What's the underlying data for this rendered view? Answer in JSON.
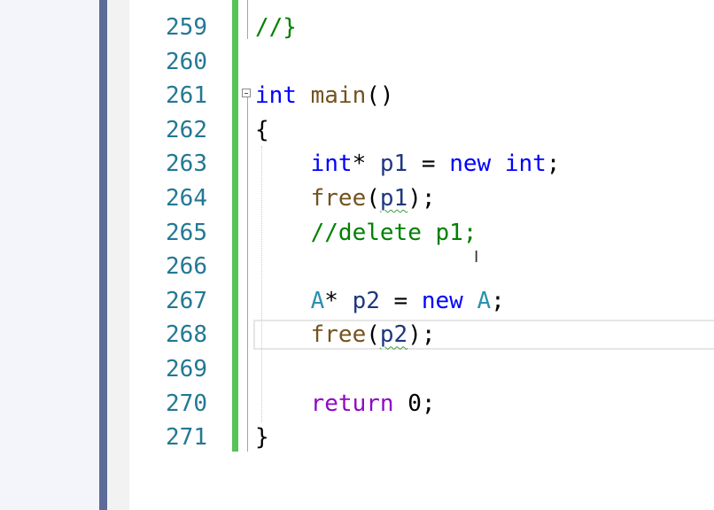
{
  "editor": {
    "lines": [
      {
        "number": "259",
        "tokens": [
          {
            "t": "//}",
            "c": "cm"
          }
        ]
      },
      {
        "number": "260",
        "tokens": []
      },
      {
        "number": "261",
        "tokens": [
          {
            "t": "int",
            "c": "kw"
          },
          {
            "t": " "
          },
          {
            "t": "main",
            "c": "fn"
          },
          {
            "t": "()"
          }
        ]
      },
      {
        "number": "262",
        "tokens": [
          {
            "t": "{"
          }
        ]
      },
      {
        "number": "263",
        "tokens": [
          {
            "t": "    "
          },
          {
            "t": "int",
            "c": "kw"
          },
          {
            "t": "* "
          },
          {
            "t": "p1",
            "c": "var"
          },
          {
            "t": " = "
          },
          {
            "t": "new",
            "c": "kw"
          },
          {
            "t": " "
          },
          {
            "t": "int",
            "c": "kw"
          },
          {
            "t": ";"
          }
        ]
      },
      {
        "number": "264",
        "tokens": [
          {
            "t": "    "
          },
          {
            "t": "free",
            "c": "fn"
          },
          {
            "t": "("
          },
          {
            "t": "p1",
            "c": "var squiggle"
          },
          {
            "t": ");"
          }
        ]
      },
      {
        "number": "265",
        "tokens": [
          {
            "t": "    "
          },
          {
            "t": "//delete p1;",
            "c": "cm"
          }
        ]
      },
      {
        "number": "266",
        "tokens": []
      },
      {
        "number": "267",
        "tokens": [
          {
            "t": "    "
          },
          {
            "t": "A",
            "c": "ty"
          },
          {
            "t": "* "
          },
          {
            "t": "p2",
            "c": "var"
          },
          {
            "t": " = "
          },
          {
            "t": "new",
            "c": "kw"
          },
          {
            "t": " "
          },
          {
            "t": "A",
            "c": "ty"
          },
          {
            "t": ";"
          }
        ]
      },
      {
        "number": "268",
        "tokens": [
          {
            "t": "    "
          },
          {
            "t": "free",
            "c": "fn"
          },
          {
            "t": "("
          },
          {
            "t": "p2",
            "c": "var squiggle"
          },
          {
            "t": ");"
          }
        ]
      },
      {
        "number": "269",
        "tokens": []
      },
      {
        "number": "270",
        "tokens": [
          {
            "t": "    "
          },
          {
            "t": "return",
            "c": "rk"
          },
          {
            "t": " 0;"
          }
        ]
      },
      {
        "number": "271",
        "tokens": [
          {
            "t": "}"
          }
        ]
      }
    ],
    "current_line": "268"
  },
  "colors": {
    "keyword": "#0000ff",
    "function": "#74531f",
    "type": "#2b91af",
    "control_keyword": "#8f08c4",
    "comment": "#008000",
    "line_number": "#237893",
    "change_bar": "#57c35a"
  },
  "icons": {
    "collapse": "collapse-minus-icon",
    "cursor": "text-cursor-icon"
  }
}
